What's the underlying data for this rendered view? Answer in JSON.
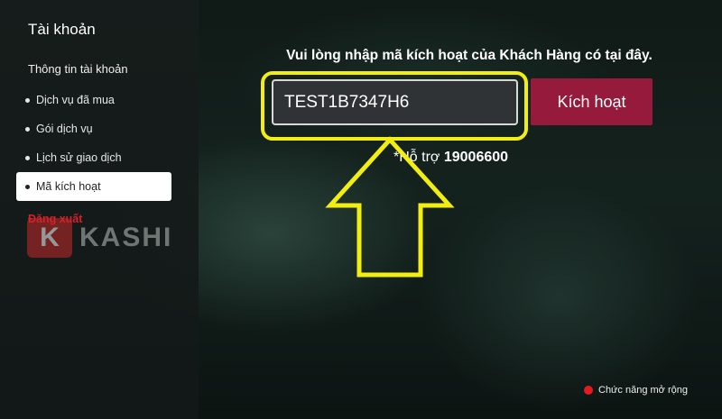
{
  "sidebar": {
    "title": "Tài khoản",
    "section_label": "Thông tin tài khoản",
    "items": [
      {
        "label": "Dịch vụ đã mua"
      },
      {
        "label": "Gói dịch vụ"
      },
      {
        "label": "Lịch sử giao dịch"
      },
      {
        "label": "Mã kích hoạt"
      }
    ],
    "logout_label": "Đăng xuất"
  },
  "watermark": {
    "letter": "K",
    "text": "KASHI"
  },
  "main": {
    "title": "Vui lòng nhập mã kích hoạt của Khách Hàng có tại đây.",
    "code_value": "TEST1B7347H6",
    "activate_label": "Kích hoạt",
    "support_prefix": "*Hỗ trợ",
    "support_number": "19006600"
  },
  "footer": {
    "extended_label": "Chức năng mở rộng"
  },
  "colors": {
    "highlight": "#f3ee12",
    "activate_button": "#951a3c",
    "logout": "#d6202a",
    "footer_dot": "#e21b23"
  },
  "icons": {
    "annotation": "arrow-up-icon",
    "footer": "red-dot-icon"
  }
}
